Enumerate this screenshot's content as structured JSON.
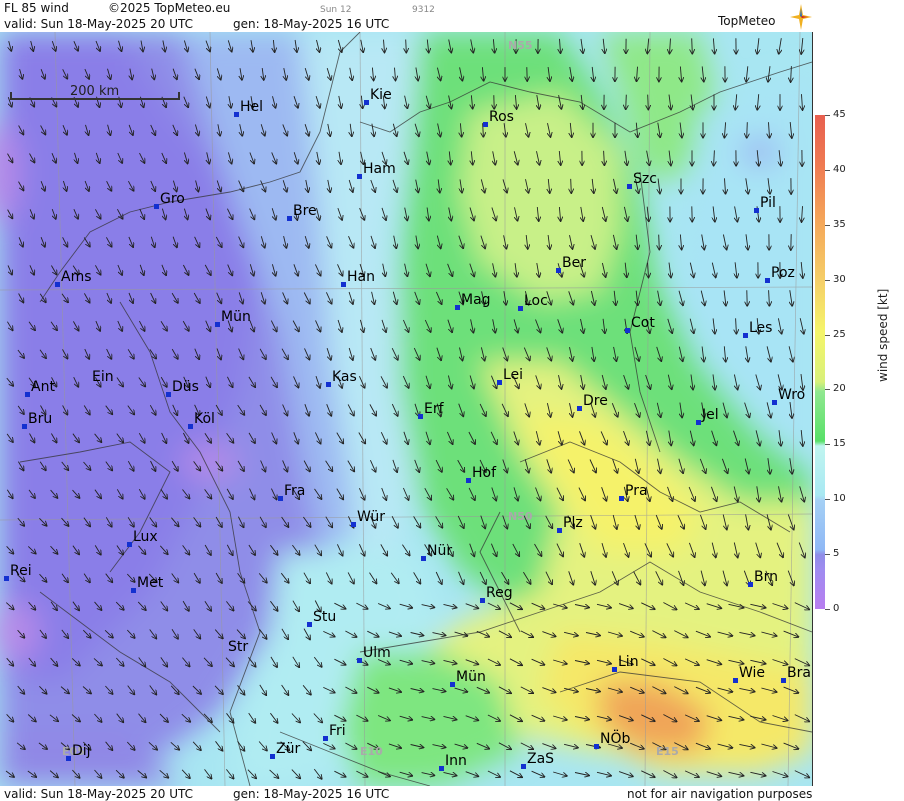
{
  "header": {
    "product": "FL 85 wind",
    "copyright": "©2025 TopMeteo.eu",
    "sun_code": "Sun 12",
    "code": "9312",
    "valid": "valid:  Sun  18-May-2025  20 UTC",
    "generated": "gen: 18-May-2025 16 UTC",
    "logo": "TopMeteo"
  },
  "footer": {
    "valid": "valid:  Sun  18-May-2025  20 UTC",
    "generated": "gen: 18-May-2025 16 UTC",
    "disclaimer": "not for air navigation purposes"
  },
  "scale": {
    "label": "200 km"
  },
  "colorbar": {
    "label": "wind speed  [kt]",
    "ticks": [
      "0",
      "5",
      "10",
      "15",
      "20",
      "25",
      "30",
      "35",
      "40",
      "45"
    ]
  },
  "grid_labels": [
    "N55",
    "N50",
    "E05",
    "E10",
    "E15"
  ],
  "cities": [
    "Hel",
    "Kie",
    "Ros",
    "Ham",
    "Szc",
    "Gro",
    "Bre",
    "Pil",
    "Ams",
    "Han",
    "Ber",
    "Poz",
    "Mag",
    "Loc",
    "Mün",
    "Cot",
    "Les",
    "Ein",
    "Kas",
    "Lei",
    "Ant",
    "Düs",
    "Dre",
    "Wro",
    "Erf",
    "Jel",
    "Bru",
    "Köl",
    "Hof",
    "Fra",
    "Pra",
    "Würz",
    "Plz",
    "Lux",
    "Nür",
    "Rei",
    "Met",
    "Reg",
    "Brn",
    "Stu",
    "Str",
    "Ulm",
    "Lin",
    "Mün2",
    "Wie",
    "Bra",
    "Fri",
    "NÖb",
    "Dij",
    "Zür",
    "Inn",
    "ZaS"
  ],
  "city_labels": {
    "Hel": "Hel",
    "Kie": "Kie",
    "Ros": "Ros",
    "Ham": "Ham",
    "Szc": "Szc",
    "Gro": "Gro",
    "Bre": "Bre",
    "Pil": "Pil",
    "Ams": "Ams",
    "Han": "Han",
    "Ber": "Ber",
    "Poz": "Poz",
    "Mag": "Mag",
    "Loc": "Loc",
    "Mün": "Mün",
    "Cot": "Cot",
    "Les": "Les",
    "Ein": "Ein",
    "Kas": "Kas",
    "Lei": "Lei",
    "Ant": "Ant",
    "Düs": "Düs",
    "Dre": "Dre",
    "Wro": "Wro",
    "Erf": "Erf",
    "Jel": "Jel",
    "Bru": "Bru",
    "Köl": "Köl",
    "Hof": "Hof",
    "Fra": "Fra",
    "Pra": "Pra",
    "Würz": "Wür",
    "Plz": "Plz",
    "Lux": "Lux",
    "Nür": "Nür",
    "Rei": "Rei",
    "Met": "Met",
    "Reg": "Reg",
    "Brn": "Brn",
    "Stu": "Stu",
    "Str": "Str",
    "Ulm": "Ulm",
    "Lin": "Lin",
    "Mün2": "Mün",
    "Wie": "Wie",
    "Bra": "Bra",
    "Fri": "Fri",
    "NÖb": "NÖb",
    "Dij": "Dij",
    "Zür": "Zür",
    "Inn": "Inn",
    "ZaS": "ZaS"
  }
}
